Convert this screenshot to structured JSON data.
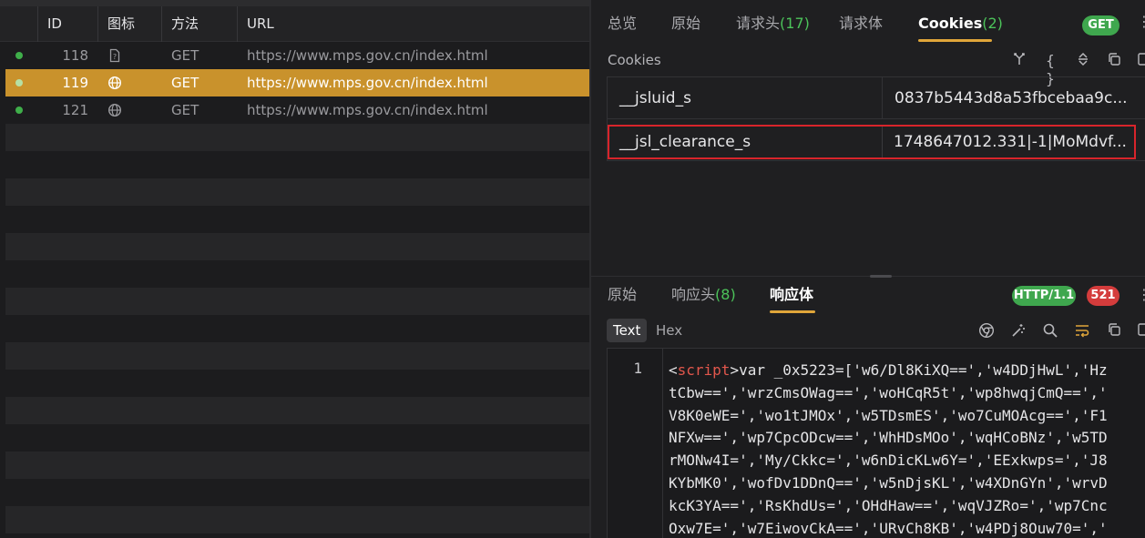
{
  "request_list": {
    "columns": [
      "ID",
      "图标",
      "方法",
      "URL"
    ],
    "rows": [
      {
        "id": "118",
        "icon": "document-icon",
        "method": "GET",
        "url": "https://www.mps.gov.cn/index.html",
        "selected": false
      },
      {
        "id": "119",
        "icon": "globe-icon",
        "method": "GET",
        "url": "https://www.mps.gov.cn/index.html",
        "selected": true
      },
      {
        "id": "121",
        "icon": "globe-icon",
        "method": "GET",
        "url": "https://www.mps.gov.cn/index.html",
        "selected": false
      }
    ],
    "status_dot_color": "#3fae4a",
    "selected_color": "#c9922c"
  },
  "request_panel": {
    "tabs": [
      {
        "label": "总览",
        "count": ""
      },
      {
        "label": "原始",
        "count": ""
      },
      {
        "label": "请求头",
        "count": "(17)"
      },
      {
        "label": "请求体",
        "count": ""
      },
      {
        "label": "Cookies",
        "count": "(2)",
        "active": true
      }
    ],
    "method_badge": "GET",
    "section_label": "Cookies",
    "toolbar_icons": [
      "merge-icon",
      "braces-icon",
      "expand-collapse-icon",
      "copy-icon",
      "layout-icon"
    ],
    "cookies": [
      {
        "name": "__jsluid_s",
        "value": "0837b5443d8a53fbcebaa9c..."
      },
      {
        "name": "__jsl_clearance_s",
        "value": "1748647012.331|-1|MoMdvf...",
        "highlighted": true
      }
    ],
    "highlight_color": "#d8242b"
  },
  "response_panel": {
    "tabs": [
      {
        "label": "原始",
        "count": ""
      },
      {
        "label": "响应头",
        "count": "(8)"
      },
      {
        "label": "响应体",
        "count": "",
        "active": true
      }
    ],
    "protocol_badge": "HTTP/1.1",
    "status_badge": "521",
    "view_modes": [
      "Text",
      "Hex"
    ],
    "active_view": "Text",
    "toolbar_icons": [
      "chrome-icon",
      "magic-wand-icon",
      "search-icon",
      "wrap-icon",
      "copy-icon",
      "layout-icon"
    ],
    "line_number": "1",
    "code": {
      "tag": "script",
      "lines": [
        "var _0x5223=['w6/Dl8KiXQ==','w4DDjHwL','Hz",
        "tCbw==','wrzCmsOWag==','woHCqR5t','wp8hwqjCmQ==','",
        "V8K0eWE=','wo1tJMOx','w5TDsmES','wo7CuMOAcg==','F1",
        "NFXw==','wp7CpcODcw==','WhHDsMOo','wqHCoBNz','w5TD",
        "rMONw4I=','My/Ckkc=','w6nDicKLw6Y=','EExkwps=','J8",
        "KYbMK0','wofDv1DDnQ==','w5nDjsKL','w4XDnGYn','wrvD",
        "kcK3YA==','RsKhdUs=','OHdHaw==','wqVJZRo=','wp7Cnc",
        "Oxw7E=','w7EiwovCkA==','URvCh8KB','w4PDj8Ouw70=','"
      ]
    }
  }
}
